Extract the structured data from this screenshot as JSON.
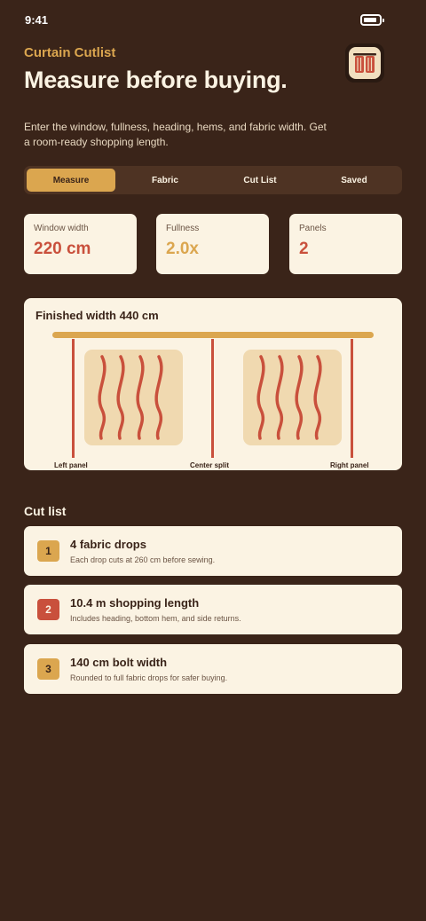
{
  "status": {
    "time": "9:41"
  },
  "header": {
    "eyebrow": "Curtain Cutlist",
    "title": "Measure before buying.",
    "intro": "Enter the window, fullness, heading, hems, and fabric width. Get a room-ready shopping length."
  },
  "tabs": [
    {
      "label": "Measure",
      "active": true
    },
    {
      "label": "Fabric",
      "active": false
    },
    {
      "label": "Cut List",
      "active": false
    },
    {
      "label": "Saved",
      "active": false
    }
  ],
  "stats": [
    {
      "label": "Window width",
      "value": "220 cm",
      "color": "#c9503c"
    },
    {
      "label": "Fullness",
      "value": "2.0x",
      "color": "#dba64f"
    },
    {
      "label": "Panels",
      "value": "2",
      "color": "#c9503c"
    }
  ],
  "preview": {
    "title": "Finished width 440 cm",
    "labels": {
      "left": "Left panel",
      "center": "Center split",
      "right": "Right panel"
    }
  },
  "cutlist": {
    "title": "Cut list",
    "items": [
      {
        "num": "1",
        "title": "4 fabric drops",
        "desc": "Each drop cuts at 260 cm before sewing.",
        "color": "#dba64f"
      },
      {
        "num": "2",
        "title": "10.4 m shopping length",
        "desc": "Includes heading, bottom hem, and side returns.",
        "color": "#c9503c"
      },
      {
        "num": "3",
        "title": "140 cm bolt width",
        "desc": "Rounded to full fabric drops for safer buying.",
        "color": "#dba64f"
      }
    ]
  },
  "colors": {
    "background": "#3a2419",
    "card": "#fbf3e3",
    "accent_gold": "#dba64f",
    "accent_red": "#c9503c",
    "panel_tan": "#f0d9b0"
  }
}
